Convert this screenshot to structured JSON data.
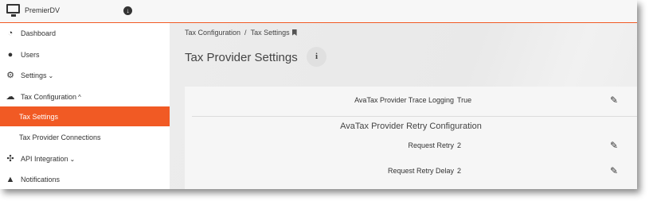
{
  "app": {
    "title": "PremierDV"
  },
  "sidebar": {
    "items": [
      {
        "label": "Dashboard",
        "icon": "dashboard-icon"
      },
      {
        "label": "Users",
        "icon": "users-icon"
      },
      {
        "label": "Settings",
        "icon": "gear-icon",
        "chevron": "⌄"
      },
      {
        "label": "Tax Configuration",
        "icon": "cloud-upload-icon",
        "chevron": "^"
      },
      {
        "label": "Tax Settings",
        "active": true
      },
      {
        "label": "Tax Provider Connections"
      },
      {
        "label": "API Integration",
        "icon": "crosshair-icon",
        "chevron": "⌄"
      },
      {
        "label": "Notifications",
        "icon": "bell-icon"
      }
    ]
  },
  "breadcrumb": {
    "parent": "Tax Configuration",
    "separator": "/",
    "current": "Tax Settings"
  },
  "page": {
    "title": "Tax Provider Settings",
    "info_label": "i"
  },
  "settings": {
    "trace_logging": {
      "label": "AvaTax Provider Trace Logging",
      "value": "True"
    },
    "section_title": "AvaTax Provider Retry Configuration",
    "request_retry": {
      "label": "Request Retry",
      "value": "2"
    },
    "request_retry_delay": {
      "label": "Request Retry Delay",
      "value": "2"
    }
  },
  "colors": {
    "accent": "#f15a24"
  }
}
